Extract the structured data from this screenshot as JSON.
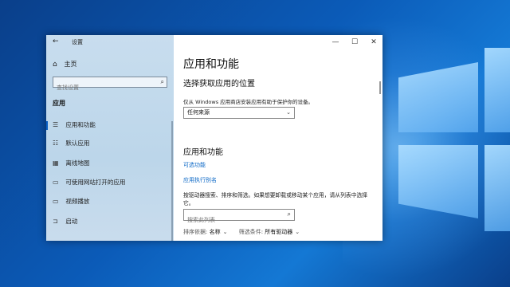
{
  "window": {
    "title": "设置",
    "controls": {
      "minimize": "—",
      "maximize": "☐",
      "close": "✕"
    }
  },
  "sidebar": {
    "home": "主页",
    "search_placeholder": "查找设置",
    "section": "应用",
    "items": [
      {
        "label": "应用和功能",
        "icon": "list-icon"
      },
      {
        "label": "默认应用",
        "icon": "default-apps-icon"
      },
      {
        "label": "离线地图",
        "icon": "map-icon"
      },
      {
        "label": "可使用网站打开的应用",
        "icon": "web-apps-icon"
      },
      {
        "label": "视频播放",
        "icon": "video-icon"
      },
      {
        "label": "启动",
        "icon": "startup-icon"
      }
    ]
  },
  "main": {
    "title": "应用和功能",
    "install_heading": "选择获取应用的位置",
    "install_desc": "仅从 Windows 应用商店安装应用有助于保护你的设备。",
    "install_source": "任何来源",
    "apps_heading": "应用和功能",
    "link_optional": "可选功能",
    "link_alias": "应用执行别名",
    "search_desc": "按驱动器搜索、排序和筛选。如果想要卸载或移动某个应用，请从列表中选择它。",
    "search_placeholder": "搜索此列表",
    "sort_label": "排序依据:",
    "sort_value": "名称",
    "filter_label": "筛选条件:",
    "filter_value": "所有驱动器"
  }
}
